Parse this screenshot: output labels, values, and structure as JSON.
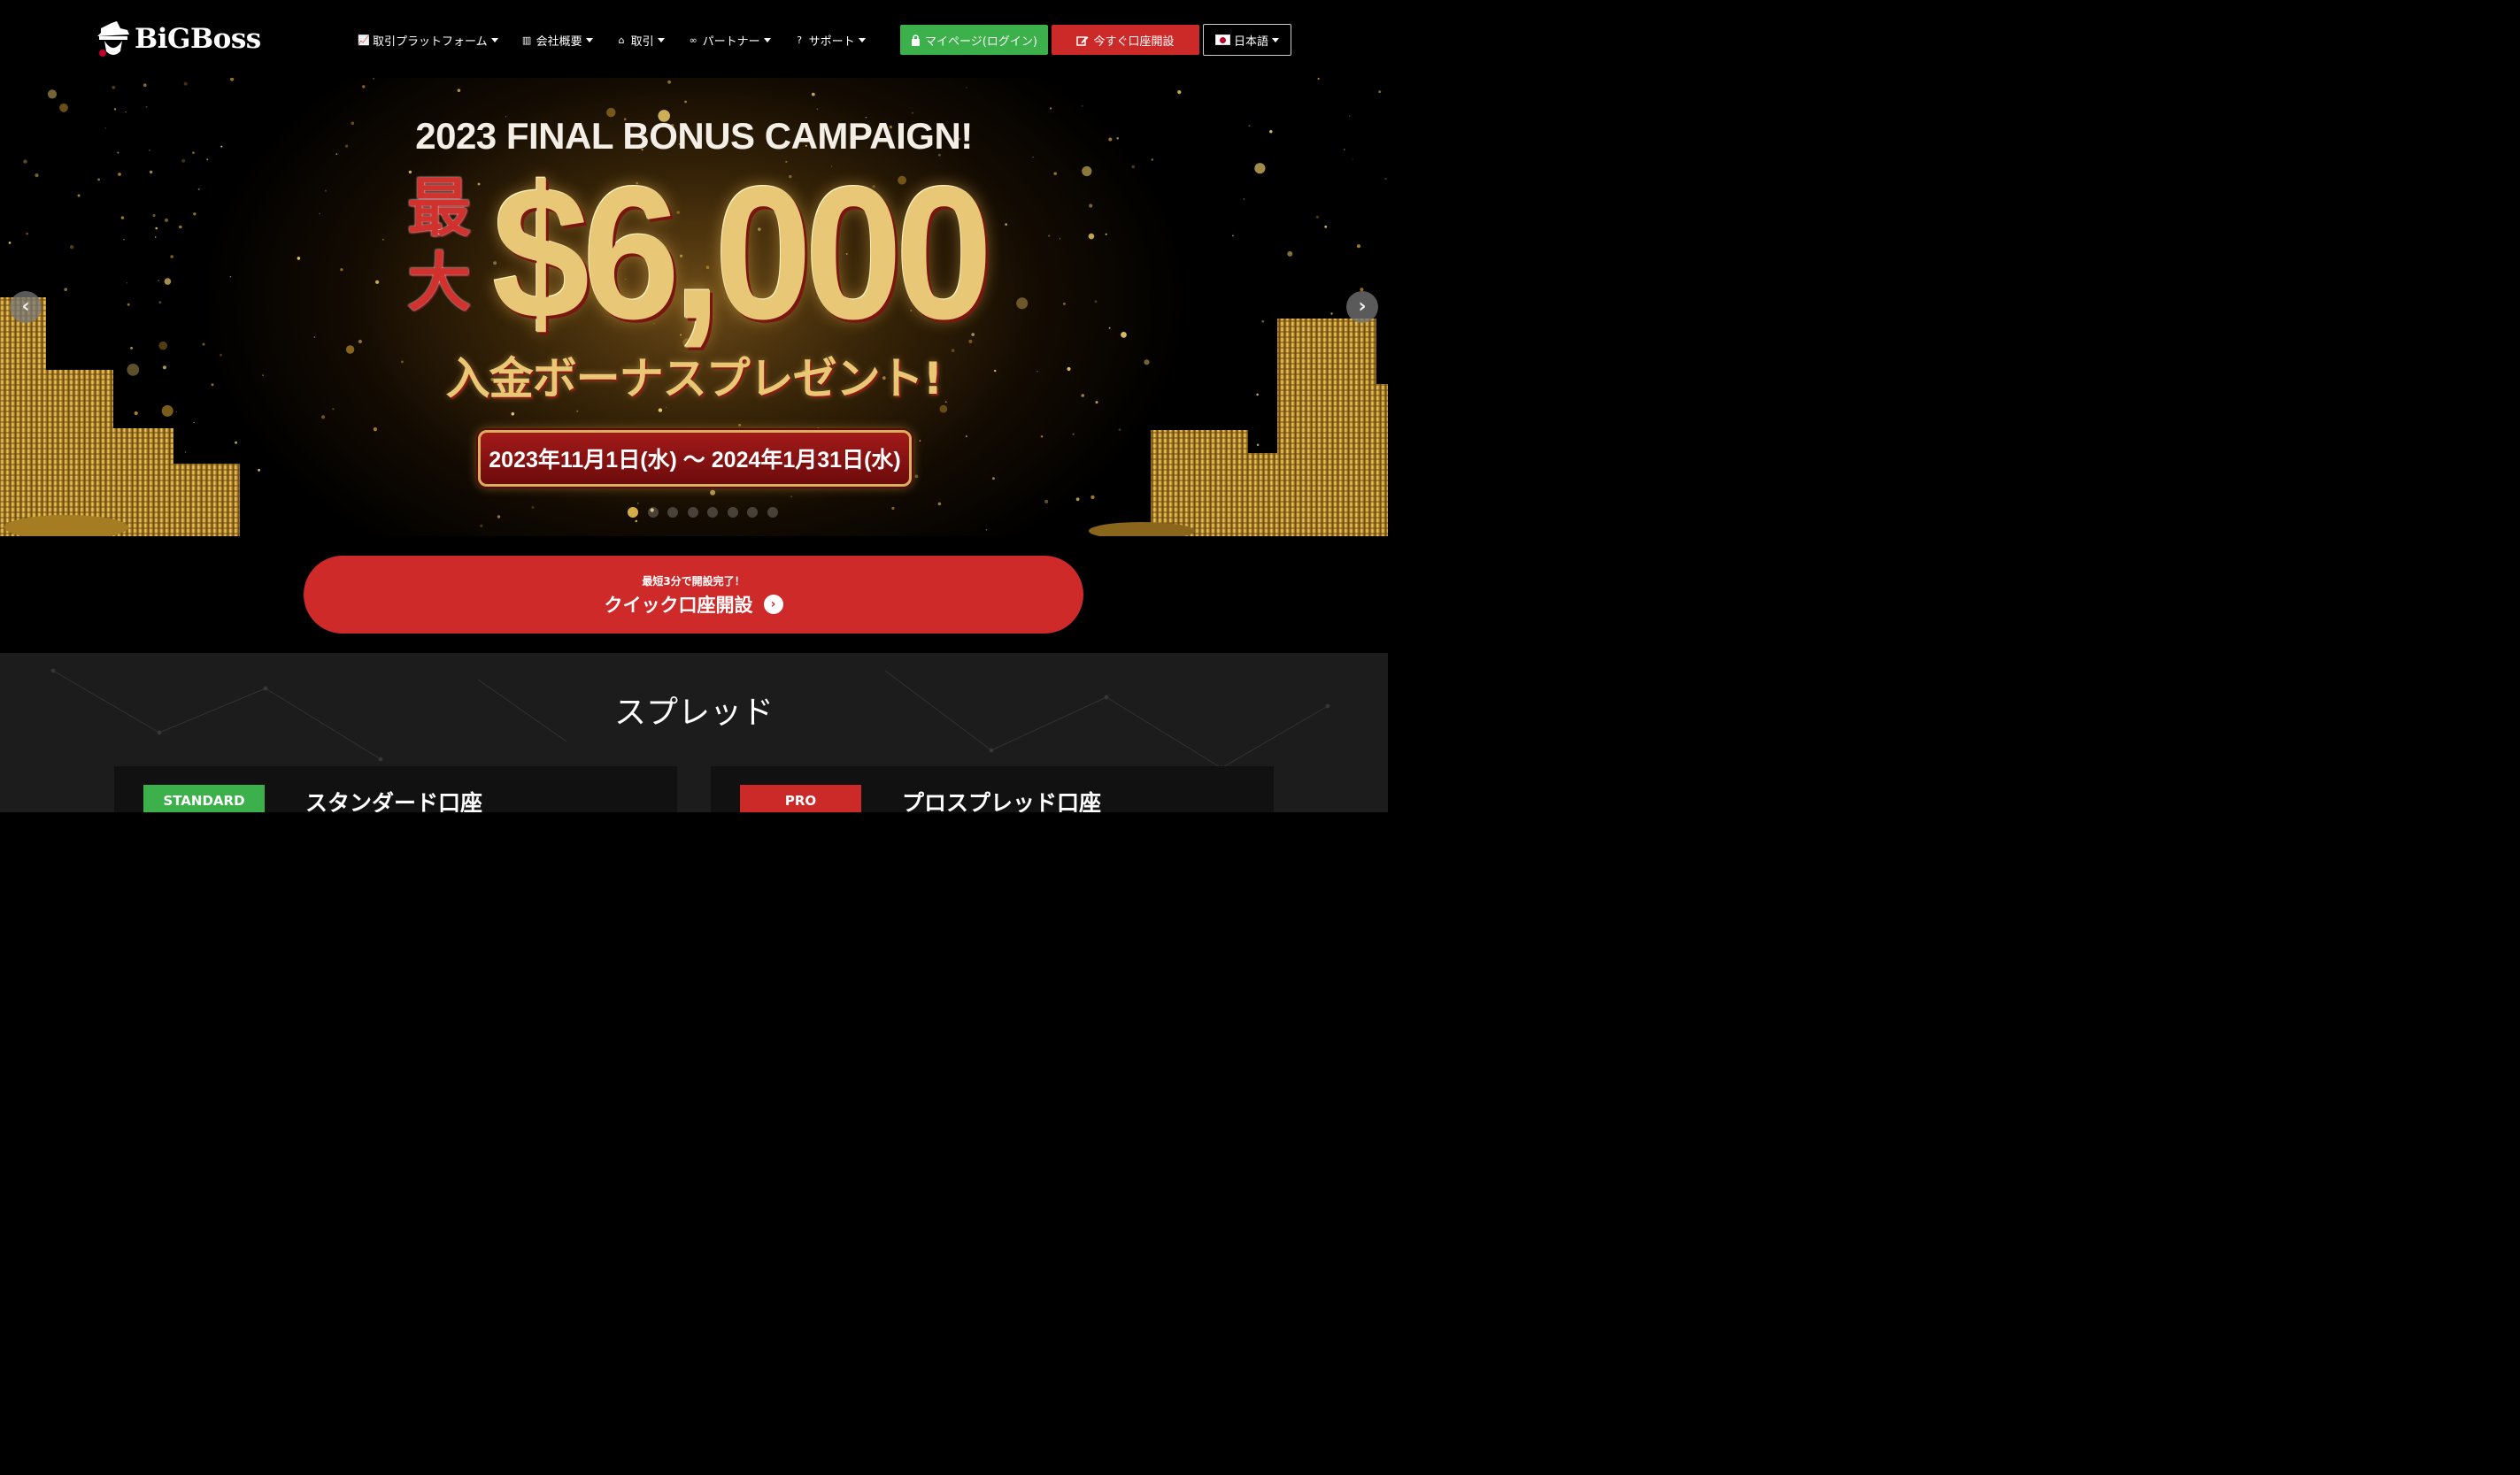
{
  "header": {
    "logo_text": "BiGBoss",
    "nav": [
      {
        "label": "取引プラットフォーム",
        "icon": "chart-line-icon"
      },
      {
        "label": "会社概要",
        "icon": "building-icon"
      },
      {
        "label": "取引",
        "icon": "bank-icon"
      },
      {
        "label": "パートナー",
        "icon": "handshake-icon"
      },
      {
        "label": "サポート",
        "icon": "question-circle-icon"
      }
    ],
    "login_label": "マイページ(ログイン)",
    "open_account_label": "今すぐ口座開設",
    "language_label": "日本語"
  },
  "hero": {
    "title": "2023 FINAL BONUS CAMPAIGN!",
    "max_label": "最大",
    "amount": "$6,000",
    "subtitle": "入金ボーナスプレゼント!",
    "date_range": "2023年11月1日(水) ～ 2024年1月31日(水)",
    "slide_count": 8,
    "active_slide": 1
  },
  "cta": {
    "small_text": "最短3分で開設完了！",
    "label": "クイック口座開設"
  },
  "spread": {
    "title": "スプレッド",
    "cards": [
      {
        "badge": "STANDARD",
        "name": "スタンダード口座"
      },
      {
        "badge": "PRO",
        "name": "プロスプレッド口座"
      }
    ]
  },
  "colors": {
    "accent_red": "#cf2a2a",
    "accent_green": "#3cb04a",
    "gold": "#e8c877"
  }
}
